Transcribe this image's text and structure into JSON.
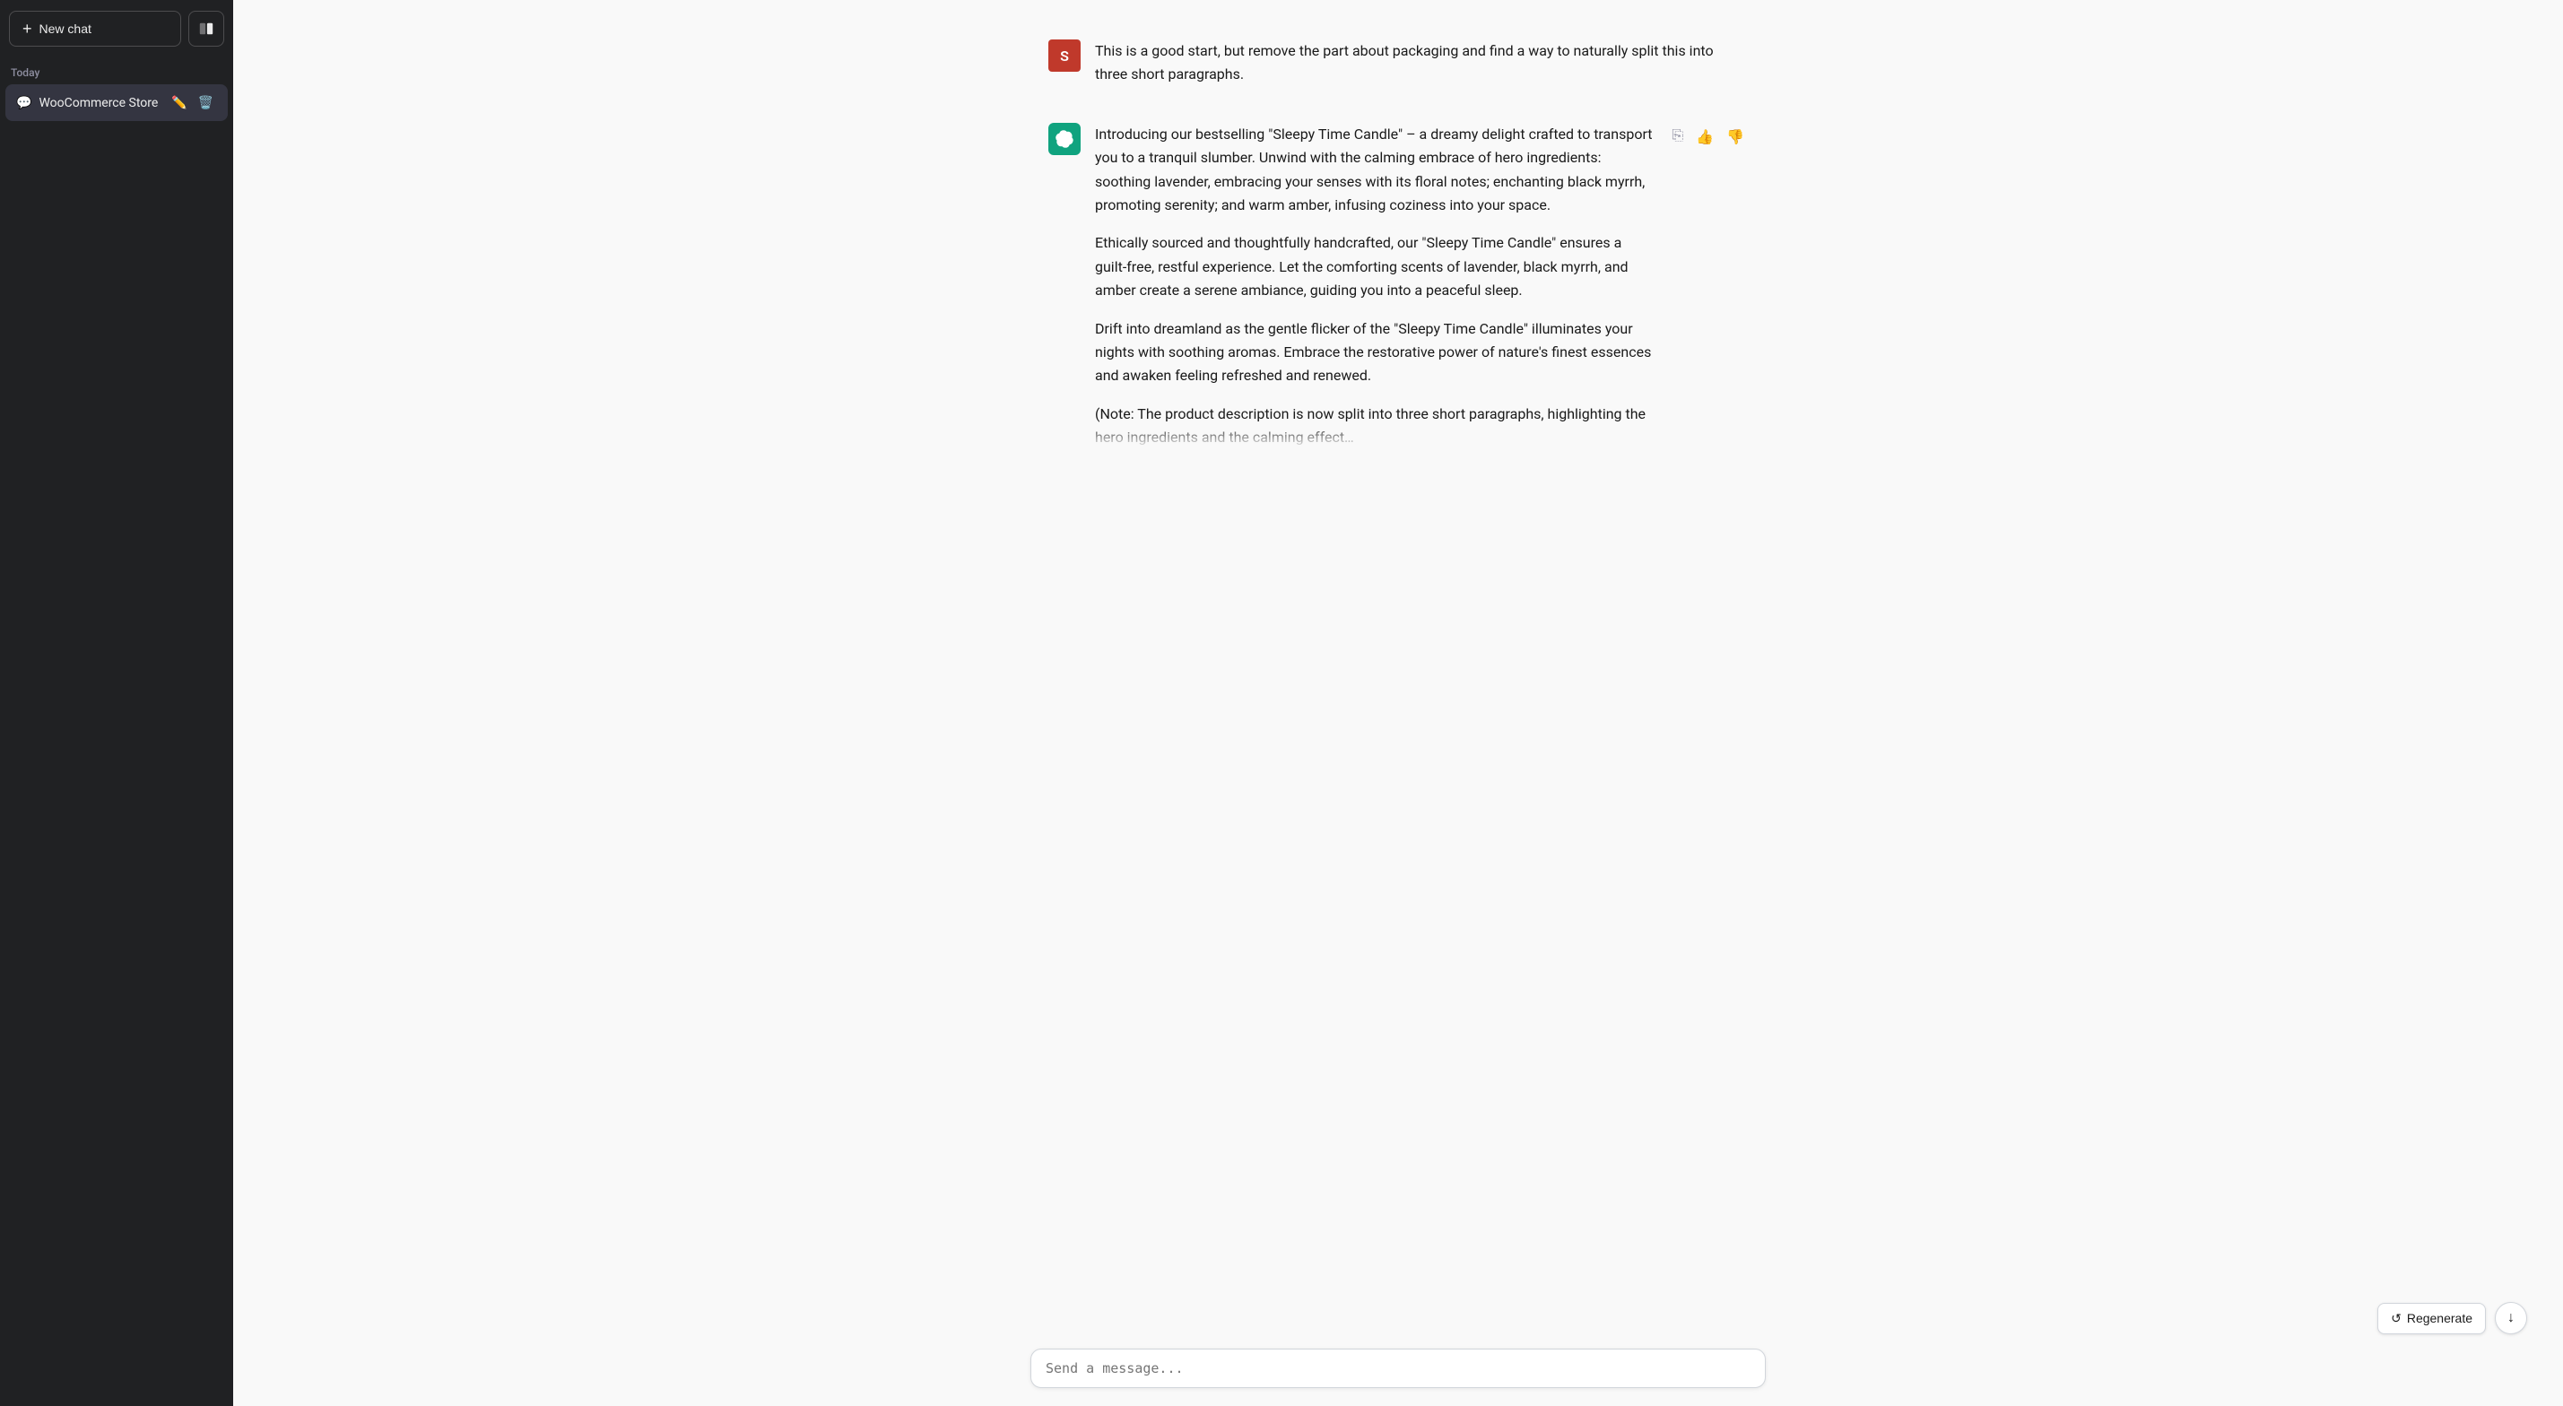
{
  "sidebar": {
    "new_chat_label": "New chat",
    "today_label": "Today",
    "chat_items": [
      {
        "id": "woocommerce",
        "label": "WooCommerce Store"
      }
    ]
  },
  "messages": [
    {
      "id": "user-1",
      "role": "user",
      "avatar_letter": "S",
      "text": "This is a good start, but remove the part about packaging and find a way to naturally split this into three short paragraphs."
    },
    {
      "id": "assistant-1",
      "role": "assistant",
      "paragraphs": [
        "Introducing our bestselling \"Sleepy Time Candle\" – a dreamy delight crafted to transport you to a tranquil slumber. Unwind with the calming embrace of hero ingredients: soothing lavender, embracing your senses with its floral notes; enchanting black myrrh, promoting serenity; and warm amber, infusing coziness into your space.",
        "Ethically sourced and thoughtfully handcrafted, our \"Sleepy Time Candle\" ensures a guilt-free, restful experience. Let the comforting scents of lavender, black myrrh, and amber create a serene ambiance, guiding you into a peaceful sleep.",
        "Drift into dreamland as the gentle flicker of the \"Sleepy Time Candle\" illuminates your nights with soothing aromas. Embrace the restorative power of nature's finest essences and awaken feeling refreshed and renewed.",
        "(Note: The product description is now split into three short paragraphs, highlighting the hero ingredients and the calming effect…"
      ]
    }
  ],
  "actions": {
    "copy_label": "⎘",
    "thumbup_label": "👍",
    "thumbdown_label": "👎",
    "regenerate_label": "Regenerate",
    "scroll_down_label": "↓"
  },
  "input": {
    "placeholder": "Send a message..."
  }
}
